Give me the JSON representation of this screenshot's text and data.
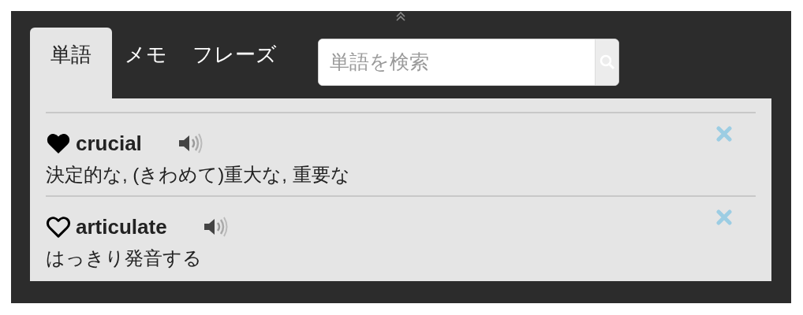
{
  "tabs": [
    {
      "label": "単語",
      "selected": true
    },
    {
      "label": "メモ",
      "selected": false
    },
    {
      "label": "フレーズ",
      "selected": false
    }
  ],
  "search": {
    "placeholder": "単語を検索"
  },
  "words": [
    {
      "word": "crucial",
      "favorite": true,
      "meaning": "決定的な, (きわめて)重大な, 重要な"
    },
    {
      "word": "articulate",
      "favorite": false,
      "meaning": "はっきり発音する"
    }
  ]
}
